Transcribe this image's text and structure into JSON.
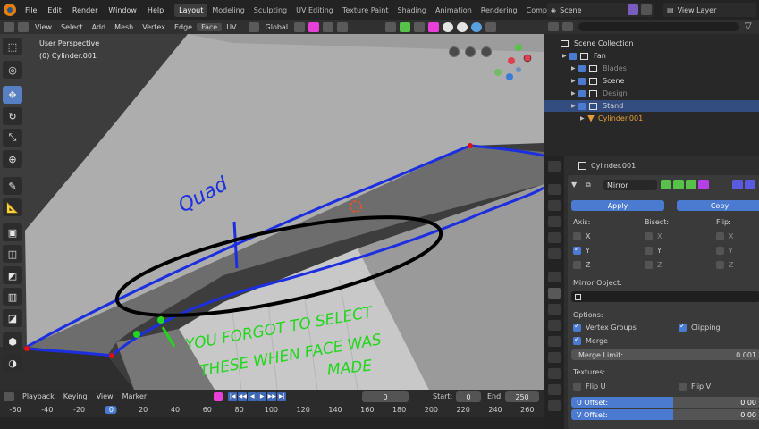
{
  "menu": [
    "File",
    "Edit",
    "Render",
    "Window",
    "Help"
  ],
  "workspaces": [
    {
      "label": "Layout",
      "active": true
    },
    {
      "label": "Modeling",
      "active": false
    },
    {
      "label": "Sculpting",
      "active": false
    },
    {
      "label": "UV Editing",
      "active": false
    },
    {
      "label": "Texture Paint",
      "active": false
    },
    {
      "label": "Shading",
      "active": false
    },
    {
      "label": "Animation",
      "active": false
    },
    {
      "label": "Rendering",
      "active": false
    },
    {
      "label": "Compositing",
      "active": false
    }
  ],
  "scene": "Scene",
  "view_layer": "View Layer",
  "viewport_header": {
    "items": [
      "View",
      "Select",
      "Add",
      "Mesh",
      "Vertex",
      "Edge",
      "Face",
      "UV"
    ],
    "active_item": "Face",
    "orientation": "Global"
  },
  "viewport": {
    "info_line1": "User Perspective",
    "info_line2": "(0) Cylinder.001"
  },
  "annotations": {
    "quad": "Quad",
    "line1": "YOU FORGOT TO SELECT",
    "line2": "THESE WHEN FACE WAS",
    "line3": "MADE"
  },
  "timeline": {
    "items": [
      "Playback",
      "Keying",
      "View",
      "Marker"
    ],
    "current_frame": "0",
    "start_label": "Start:",
    "start": "0",
    "end_label": "End:",
    "end": "250",
    "ruler": [
      "-60",
      "-40",
      "-20",
      "0",
      "20",
      "40",
      "60",
      "80",
      "100",
      "120",
      "140",
      "160",
      "180",
      "200",
      "220",
      "240",
      "260"
    ]
  },
  "outliner": {
    "rows": [
      {
        "label": "Scene Collection",
        "indent": 0,
        "selected": false,
        "dim": false
      },
      {
        "label": "Fan",
        "indent": 1,
        "selected": false,
        "dim": false
      },
      {
        "label": "Blades",
        "indent": 2,
        "selected": false,
        "dim": true
      },
      {
        "label": "Scene",
        "indent": 2,
        "selected": false,
        "dim": false
      },
      {
        "label": "Design",
        "indent": 2,
        "selected": false,
        "dim": true
      },
      {
        "label": "Stand",
        "indent": 2,
        "selected": true,
        "dim": false
      },
      {
        "label": "Cylinder.001",
        "indent": 3,
        "selected": false,
        "dim": false
      }
    ]
  },
  "properties": {
    "object_name": "Cylinder.001",
    "modifier_name": "Mirror",
    "apply": "Apply",
    "copy": "Copy",
    "axis_label": "Axis:",
    "bisect_label": "Bisect:",
    "flip_label": "Flip:",
    "x": "X",
    "y": "Y",
    "z": "Z",
    "mirror_object": "Mirror Object:",
    "options": "Options:",
    "vertex_groups": "Vertex Groups",
    "clipping": "Clipping",
    "merge": "Merge",
    "merge_limit_label": "Merge Limit:",
    "merge_limit_value": "0.001",
    "textures": "Textures:",
    "flip_u": "Flip U",
    "flip_v": "Flip V",
    "u_offset_label": "U Offset:",
    "u_offset_value": "0.00",
    "v_offset_label": "V Offset:",
    "v_offset_value": "0.00"
  },
  "colors": {
    "accent": "#4b7bd0",
    "annotation_blue": "#1c2fe0",
    "annotation_green": "#22d61e",
    "annotation_black": "#000000",
    "selected_vertex": "#e01010"
  }
}
